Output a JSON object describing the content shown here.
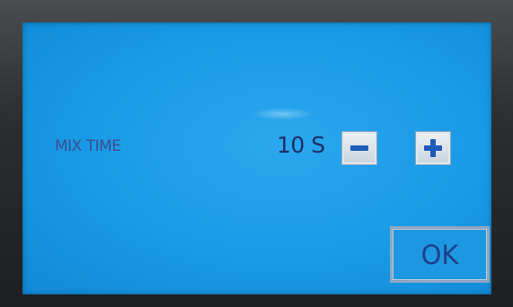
{
  "mix_time": {
    "label": "MIX TIME",
    "value": "10 S"
  },
  "buttons": {
    "decrement_icon": "minus-icon",
    "increment_icon": "plus-icon",
    "ok_label": "OK"
  },
  "colors": {
    "screen_background": "#189ae6",
    "button_icon": "#1b5db8",
    "text": "#1e2d66"
  }
}
